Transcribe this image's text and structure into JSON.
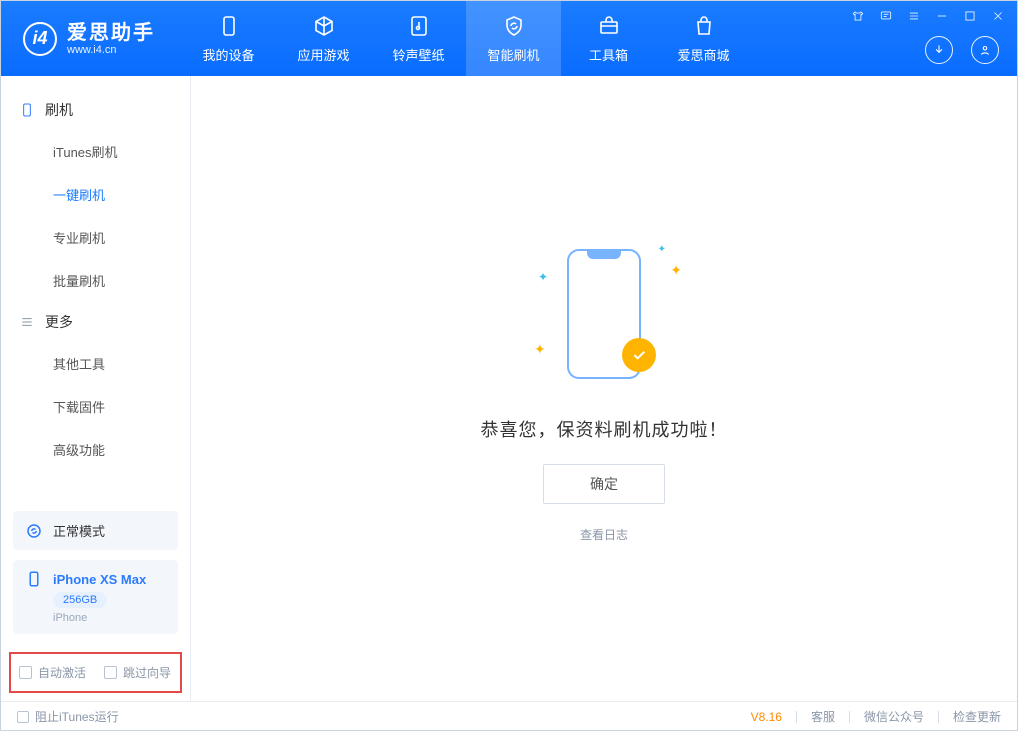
{
  "app": {
    "title": "爱思助手",
    "subtitle": "www.i4.cn"
  },
  "header_tabs": [
    "我的设备",
    "应用游戏",
    "铃声壁纸",
    "智能刷机",
    "工具箱",
    "爱思商城"
  ],
  "active_header_tab": 3,
  "sidebar": {
    "group_flash": {
      "label": "刷机",
      "items": [
        "iTunes刷机",
        "一键刷机",
        "专业刷机",
        "批量刷机"
      ],
      "active_index": 1
    },
    "group_more": {
      "label": "更多",
      "items": [
        "其他工具",
        "下载固件",
        "高级功能"
      ]
    },
    "mode_card": "正常模式",
    "device": {
      "name": "iPhone XS Max",
      "storage": "256GB",
      "type": "iPhone"
    },
    "checkboxes": {
      "auto_activate": "自动激活",
      "skip_guide": "跳过向导"
    }
  },
  "main": {
    "success_message": "恭喜您，保资料刷机成功啦！",
    "ok_button": "确定",
    "view_log": "查看日志"
  },
  "footer": {
    "block_itunes": "阻止iTunes运行",
    "version": "V8.16",
    "links": [
      "客服",
      "微信公众号",
      "检查更新"
    ]
  }
}
